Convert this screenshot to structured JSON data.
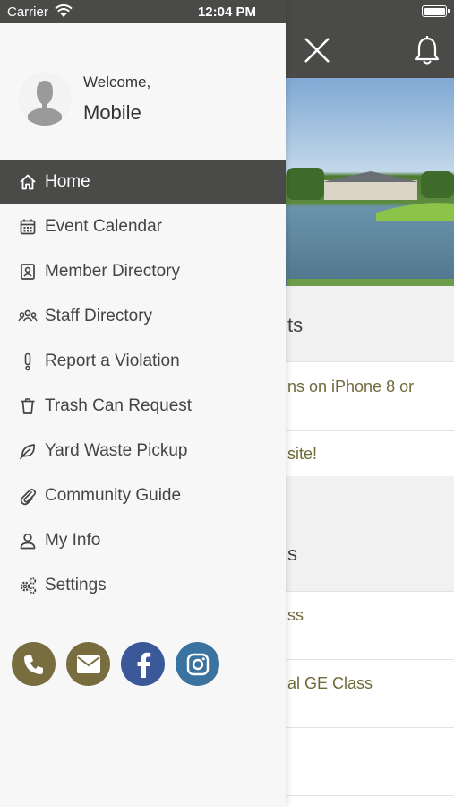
{
  "status_bar": {
    "carrier": "Carrier",
    "time": "12:04 PM"
  },
  "drawer": {
    "welcome": "Welcome,",
    "username": "Mobile",
    "menu": [
      {
        "label": "Home",
        "icon": "home-icon",
        "active": true
      },
      {
        "label": "Event Calendar",
        "icon": "calendar-icon"
      },
      {
        "label": "Member Directory",
        "icon": "contact-card-icon"
      },
      {
        "label": "Staff Directory",
        "icon": "people-group-icon"
      },
      {
        "label": "Report a Violation",
        "icon": "exclamation-icon"
      },
      {
        "label": "Trash Can Request",
        "icon": "trash-can-icon"
      },
      {
        "label": "Yard Waste Pickup",
        "icon": "leaf-icon"
      },
      {
        "label": "Community Guide",
        "icon": "paperclip-icon"
      },
      {
        "label": "My Info",
        "icon": "user-icon"
      },
      {
        "label": "Settings",
        "icon": "gears-icon"
      }
    ],
    "socials": [
      {
        "name": "phone-icon",
        "color": "#786d3f"
      },
      {
        "name": "email-icon",
        "color": "#786d3f"
      },
      {
        "name": "facebook-icon",
        "color": "#3b5998"
      },
      {
        "name": "instagram-icon",
        "color": "#3a73a0"
      }
    ]
  },
  "background": {
    "section1_title_fragment": "ts",
    "row1_fragment": "ns on iPhone 8 or",
    "row2_fragment": "site!",
    "section2_title_fragment": "s",
    "row3_fragment": "ss",
    "row4_fragment": "al GE Class"
  },
  "colors": {
    "header": "#4a4a48",
    "accent_text": "#6f6a3a",
    "drawer_bg": "#f7f7f7"
  }
}
